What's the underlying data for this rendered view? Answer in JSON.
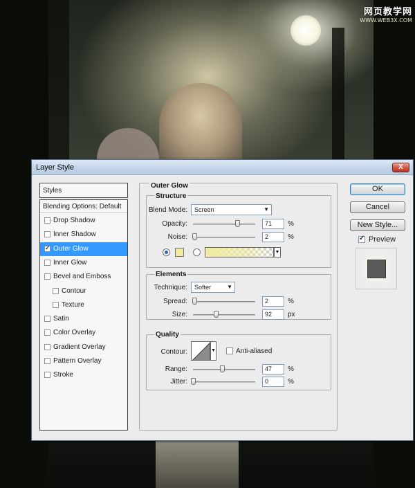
{
  "watermark": {
    "site": "网页教学网",
    "url": "WWW.WEB3X.COM"
  },
  "dialog": {
    "title": "Layer Style",
    "close_label": "X",
    "styles_header": "Styles",
    "blending_options": "Blending Options: Default",
    "style_items": [
      {
        "label": "Drop Shadow",
        "checked": false
      },
      {
        "label": "Inner Shadow",
        "checked": false
      },
      {
        "label": "Outer Glow",
        "checked": true,
        "selected": true
      },
      {
        "label": "Inner Glow",
        "checked": false
      },
      {
        "label": "Bevel and Emboss",
        "checked": false
      },
      {
        "label": "Contour",
        "checked": false
      },
      {
        "label": "Texture",
        "checked": false
      },
      {
        "label": "Satin",
        "checked": false
      },
      {
        "label": "Color Overlay",
        "checked": false
      },
      {
        "label": "Gradient Overlay",
        "checked": false
      },
      {
        "label": "Pattern Overlay",
        "checked": false
      },
      {
        "label": "Stroke",
        "checked": false
      }
    ],
    "panel_title": "Outer Glow",
    "structure": {
      "title": "Structure",
      "blend_mode_label": "Blend Mode:",
      "blend_mode_value": "Screen",
      "opacity_label": "Opacity:",
      "opacity_value": "71",
      "opacity_unit": "%",
      "opacity_level": 0.71,
      "noise_label": "Noise:",
      "noise_value": "2",
      "noise_unit": "%",
      "noise_level": 0.02,
      "glow_color": "#f0eba0"
    },
    "elements": {
      "title": "Elements",
      "technique_label": "Technique:",
      "technique_value": "Softer",
      "spread_label": "Spread:",
      "spread_value": "2",
      "spread_unit": "%",
      "spread_level": 0.02,
      "size_label": "Size:",
      "size_value": "92",
      "size_unit": "px",
      "size_level": 0.37
    },
    "quality": {
      "title": "Quality",
      "contour_label": "Contour:",
      "anti_aliased_label": "Anti-aliased",
      "anti_aliased_checked": false,
      "range_label": "Range:",
      "range_value": "47",
      "range_unit": "%",
      "range_level": 0.47,
      "jitter_label": "Jitter:",
      "jitter_value": "0",
      "jitter_unit": "%",
      "jitter_level": 0.0
    },
    "buttons": {
      "ok": "OK",
      "cancel": "Cancel",
      "new_style": "New Style..."
    },
    "preview": {
      "label": "Preview",
      "checked": true
    }
  }
}
